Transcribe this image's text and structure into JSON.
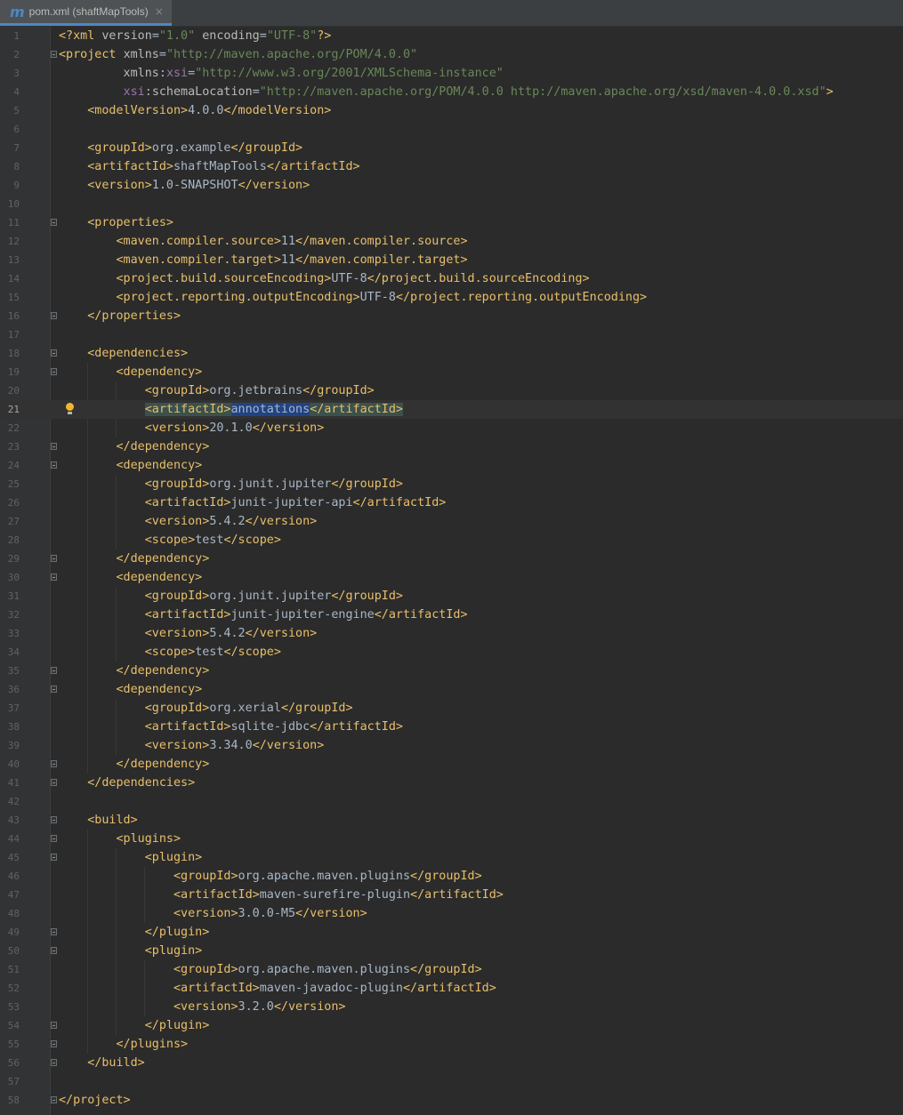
{
  "tab": {
    "icon": "m",
    "title": "pom.xml (shaftMapTools)",
    "close": "×"
  },
  "code_lines": [
    {
      "n": "1",
      "segs": [
        [
          "tag",
          "<?xml "
        ],
        [
          "attr",
          "version"
        ],
        [
          "t",
          "="
        ],
        [
          "val",
          "\"1.0\""
        ],
        [
          "attr",
          " encoding"
        ],
        [
          "t",
          "="
        ],
        [
          "val",
          "\"UTF-8\""
        ],
        [
          "tag",
          "?>"
        ]
      ]
    },
    {
      "n": "2",
      "fold": true,
      "segs": [
        [
          "tag",
          "<project "
        ],
        [
          "attr",
          "xmlns"
        ],
        [
          "t",
          "="
        ],
        [
          "val",
          "\"http://maven.apache.org/POM/4.0.0\""
        ]
      ]
    },
    {
      "n": "3",
      "segs": [
        [
          "attr",
          "         xmlns"
        ],
        [
          "t",
          ":"
        ],
        [
          "ns",
          "xsi"
        ],
        [
          "t",
          "="
        ],
        [
          "val",
          "\"http://www.w3.org/2001/XMLSchema-instance\""
        ]
      ]
    },
    {
      "n": "4",
      "segs": [
        [
          "ns",
          "         xsi"
        ],
        [
          "t",
          ":"
        ],
        [
          "attr",
          "schemaLocation"
        ],
        [
          "t",
          "="
        ],
        [
          "val",
          "\"http://maven.apache.org/POM/4.0.0 http://maven.apache.org/xsd/maven-4.0.0.xsd\""
        ],
        [
          "tag",
          ">"
        ]
      ]
    },
    {
      "n": "5",
      "segs": [
        [
          "tag",
          "    <modelVersion>"
        ],
        [
          "t",
          "4.0.0"
        ],
        [
          "tag",
          "</modelVersion>"
        ]
      ]
    },
    {
      "n": "6",
      "segs": []
    },
    {
      "n": "7",
      "segs": [
        [
          "tag",
          "    <groupId>"
        ],
        [
          "t",
          "org.example"
        ],
        [
          "tag",
          "</groupId>"
        ]
      ]
    },
    {
      "n": "8",
      "segs": [
        [
          "tag",
          "    <artifactId>"
        ],
        [
          "t",
          "shaftMapTools"
        ],
        [
          "tag",
          "</artifactId>"
        ]
      ]
    },
    {
      "n": "9",
      "segs": [
        [
          "tag",
          "    <version>"
        ],
        [
          "t",
          "1.0-SNAPSHOT"
        ],
        [
          "tag",
          "</version>"
        ]
      ]
    },
    {
      "n": "10",
      "segs": []
    },
    {
      "n": "11",
      "fold": true,
      "segs": [
        [
          "tag",
          "    <properties>"
        ]
      ]
    },
    {
      "n": "12",
      "segs": [
        [
          "tag",
          "        <maven.compiler.source>"
        ],
        [
          "t",
          "11"
        ],
        [
          "tag",
          "</maven.compiler.source>"
        ]
      ]
    },
    {
      "n": "13",
      "segs": [
        [
          "tag",
          "        <maven.compiler.target>"
        ],
        [
          "t",
          "11"
        ],
        [
          "tag",
          "</maven.compiler.target>"
        ]
      ]
    },
    {
      "n": "14",
      "segs": [
        [
          "tag",
          "        <project.build.sourceEncoding>"
        ],
        [
          "t",
          "UTF-8"
        ],
        [
          "tag",
          "</project.build.sourceEncoding>"
        ]
      ]
    },
    {
      "n": "15",
      "segs": [
        [
          "tag",
          "        <project.reporting.outputEncoding>"
        ],
        [
          "t",
          "UTF-8"
        ],
        [
          "tag",
          "</project.reporting.outputEncoding>"
        ]
      ]
    },
    {
      "n": "16",
      "fold": true,
      "segs": [
        [
          "tag",
          "    </properties>"
        ]
      ]
    },
    {
      "n": "17",
      "segs": []
    },
    {
      "n": "18",
      "fold": true,
      "segs": [
        [
          "tag",
          "    <dependencies>"
        ]
      ]
    },
    {
      "n": "19",
      "fold": true,
      "segs": [
        [
          "tag",
          "        <dependency>"
        ]
      ]
    },
    {
      "n": "20",
      "segs": [
        [
          "tag",
          "            <groupId>"
        ],
        [
          "t",
          "org.jetbrains"
        ],
        [
          "tag",
          "</groupId>"
        ]
      ]
    },
    {
      "n": "21",
      "current": true,
      "bulb": true,
      "segs": [
        [
          "t",
          "            "
        ],
        [
          "tag hl-tag",
          "<artifactId>"
        ],
        [
          "t hl-word",
          "annotations"
        ],
        [
          "tag hl-tag",
          "</artifactId>"
        ]
      ]
    },
    {
      "n": "22",
      "segs": [
        [
          "tag",
          "            <version>"
        ],
        [
          "t",
          "20.1.0"
        ],
        [
          "tag",
          "</version>"
        ]
      ]
    },
    {
      "n": "23",
      "fold": true,
      "segs": [
        [
          "tag",
          "        </dependency>"
        ]
      ]
    },
    {
      "n": "24",
      "fold": true,
      "segs": [
        [
          "tag",
          "        <dependency>"
        ]
      ]
    },
    {
      "n": "25",
      "segs": [
        [
          "tag",
          "            <groupId>"
        ],
        [
          "t",
          "org.junit.jupiter"
        ],
        [
          "tag",
          "</groupId>"
        ]
      ]
    },
    {
      "n": "26",
      "segs": [
        [
          "tag",
          "            <artifactId>"
        ],
        [
          "t",
          "junit-jupiter-api"
        ],
        [
          "tag",
          "</artifactId>"
        ]
      ]
    },
    {
      "n": "27",
      "segs": [
        [
          "tag",
          "            <version>"
        ],
        [
          "t",
          "5.4.2"
        ],
        [
          "tag",
          "</version>"
        ]
      ]
    },
    {
      "n": "28",
      "segs": [
        [
          "tag",
          "            <scope>"
        ],
        [
          "t",
          "test"
        ],
        [
          "tag",
          "</scope>"
        ]
      ]
    },
    {
      "n": "29",
      "fold": true,
      "segs": [
        [
          "tag",
          "        </dependency>"
        ]
      ]
    },
    {
      "n": "30",
      "fold": true,
      "segs": [
        [
          "tag",
          "        <dependency>"
        ]
      ]
    },
    {
      "n": "31",
      "segs": [
        [
          "tag",
          "            <groupId>"
        ],
        [
          "t",
          "org.junit.jupiter"
        ],
        [
          "tag",
          "</groupId>"
        ]
      ]
    },
    {
      "n": "32",
      "segs": [
        [
          "tag",
          "            <artifactId>"
        ],
        [
          "t",
          "junit-jupiter-engine"
        ],
        [
          "tag",
          "</artifactId>"
        ]
      ]
    },
    {
      "n": "33",
      "segs": [
        [
          "tag",
          "            <version>"
        ],
        [
          "t",
          "5.4.2"
        ],
        [
          "tag",
          "</version>"
        ]
      ]
    },
    {
      "n": "34",
      "segs": [
        [
          "tag",
          "            <scope>"
        ],
        [
          "t",
          "test"
        ],
        [
          "tag",
          "</scope>"
        ]
      ]
    },
    {
      "n": "35",
      "fold": true,
      "segs": [
        [
          "tag",
          "        </dependency>"
        ]
      ]
    },
    {
      "n": "36",
      "fold": true,
      "segs": [
        [
          "tag",
          "        <dependency>"
        ]
      ]
    },
    {
      "n": "37",
      "segs": [
        [
          "tag",
          "            <groupId>"
        ],
        [
          "t",
          "org.xerial"
        ],
        [
          "tag",
          "</groupId>"
        ]
      ]
    },
    {
      "n": "38",
      "segs": [
        [
          "tag",
          "            <artifactId>"
        ],
        [
          "t",
          "sqlite-jdbc"
        ],
        [
          "tag",
          "</artifactId>"
        ]
      ]
    },
    {
      "n": "39",
      "segs": [
        [
          "tag",
          "            <version>"
        ],
        [
          "t",
          "3.34.0"
        ],
        [
          "tag",
          "</version>"
        ]
      ]
    },
    {
      "n": "40",
      "fold": true,
      "segs": [
        [
          "tag",
          "        </dependency>"
        ]
      ]
    },
    {
      "n": "41",
      "fold": true,
      "segs": [
        [
          "tag",
          "    </dependencies>"
        ]
      ]
    },
    {
      "n": "42",
      "segs": []
    },
    {
      "n": "43",
      "fold": true,
      "segs": [
        [
          "tag",
          "    <build>"
        ]
      ]
    },
    {
      "n": "44",
      "fold": true,
      "segs": [
        [
          "tag",
          "        <plugins>"
        ]
      ]
    },
    {
      "n": "45",
      "fold": true,
      "segs": [
        [
          "tag",
          "            <plugin>"
        ]
      ]
    },
    {
      "n": "46",
      "segs": [
        [
          "tag",
          "                <groupId>"
        ],
        [
          "t",
          "org.apache.maven.plugins"
        ],
        [
          "tag",
          "</groupId>"
        ]
      ]
    },
    {
      "n": "47",
      "segs": [
        [
          "tag",
          "                <artifactId>"
        ],
        [
          "t",
          "maven-surefire-plugin"
        ],
        [
          "tag",
          "</artifactId>"
        ]
      ]
    },
    {
      "n": "48",
      "segs": [
        [
          "tag",
          "                <version>"
        ],
        [
          "t",
          "3.0.0-M5"
        ],
        [
          "tag",
          "</version>"
        ]
      ]
    },
    {
      "n": "49",
      "fold": true,
      "segs": [
        [
          "tag",
          "            </plugin>"
        ]
      ]
    },
    {
      "n": "50",
      "fold": true,
      "segs": [
        [
          "tag",
          "            <plugin>"
        ]
      ]
    },
    {
      "n": "51",
      "segs": [
        [
          "tag",
          "                <groupId>"
        ],
        [
          "t",
          "org.apache.maven.plugins"
        ],
        [
          "tag",
          "</groupId>"
        ]
      ]
    },
    {
      "n": "52",
      "segs": [
        [
          "tag",
          "                <artifactId>"
        ],
        [
          "t",
          "maven-javadoc-plugin"
        ],
        [
          "tag",
          "</artifactId>"
        ]
      ]
    },
    {
      "n": "53",
      "segs": [
        [
          "tag",
          "                <version>"
        ],
        [
          "t",
          "3.2.0"
        ],
        [
          "tag",
          "</version>"
        ]
      ]
    },
    {
      "n": "54",
      "fold": true,
      "segs": [
        [
          "tag",
          "            </plugin>"
        ]
      ]
    },
    {
      "n": "55",
      "fold": true,
      "segs": [
        [
          "tag",
          "        </plugins>"
        ]
      ]
    },
    {
      "n": "56",
      "fold": true,
      "segs": [
        [
          "tag",
          "    </build>"
        ]
      ]
    },
    {
      "n": "57",
      "segs": []
    },
    {
      "n": "58",
      "fold": true,
      "segs": [
        [
          "tag",
          "</project>"
        ]
      ]
    }
  ],
  "colors": {
    "background": "#2b2b2b",
    "gutter": "#313335",
    "tag": "#e8bf6a",
    "attribute": "#bababa",
    "namespace": "#9876aa",
    "string": "#6a8759",
    "text": "#a9b7c6",
    "selection": "#214283",
    "caret_row": "#323232"
  }
}
